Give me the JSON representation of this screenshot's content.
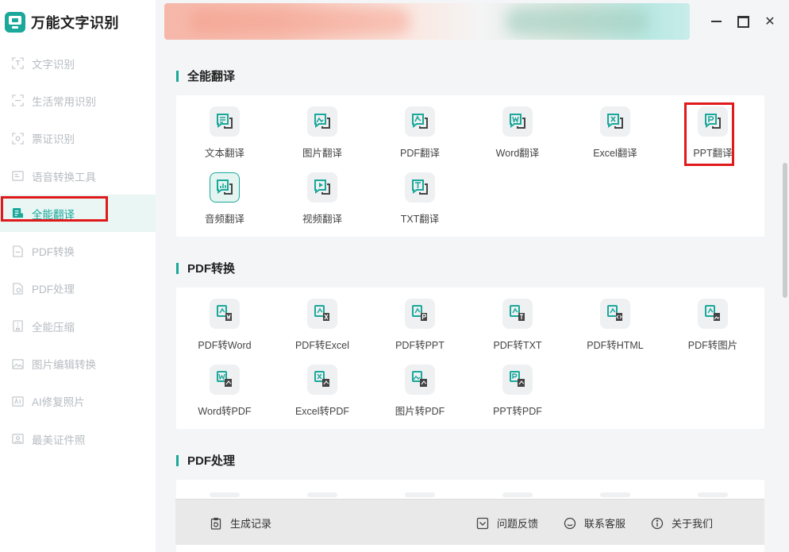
{
  "app": {
    "title": "万能文字识别"
  },
  "sidebar": {
    "items": [
      {
        "label": "文字识别",
        "icon": "scan-text-icon"
      },
      {
        "label": "生活常用识别",
        "icon": "scan-life-icon"
      },
      {
        "label": "票证识别",
        "icon": "scan-ticket-icon"
      },
      {
        "label": "语音转换工具",
        "icon": "voice-convert-icon"
      },
      {
        "label": "全能翻译",
        "icon": "translate-icon",
        "active": true
      },
      {
        "label": "PDF转换",
        "icon": "pdf-convert-icon"
      },
      {
        "label": "PDF处理",
        "icon": "pdf-process-icon"
      },
      {
        "label": "全能压缩",
        "icon": "compress-icon"
      },
      {
        "label": "图片编辑转换",
        "icon": "image-edit-icon"
      },
      {
        "label": "AI修复照片",
        "icon": "ai-repair-icon"
      },
      {
        "label": "最美证件照",
        "icon": "id-photo-icon"
      }
    ]
  },
  "sections": {
    "translate": {
      "title": "全能翻译",
      "tiles": [
        {
          "label": "文本翻译",
          "icon": "text-translate-icon"
        },
        {
          "label": "图片翻译",
          "icon": "image-translate-icon"
        },
        {
          "label": "PDF翻译",
          "icon": "pdf-translate-icon"
        },
        {
          "label": "Word翻译",
          "icon": "word-translate-icon"
        },
        {
          "label": "Excel翻译",
          "icon": "excel-translate-icon"
        },
        {
          "label": "PPT翻译",
          "icon": "ppt-translate-icon",
          "highlighted": true
        },
        {
          "label": "音频翻译",
          "icon": "audio-translate-icon"
        },
        {
          "label": "视频翻译",
          "icon": "video-translate-icon"
        },
        {
          "label": "TXT翻译",
          "icon": "txt-translate-icon"
        }
      ]
    },
    "pdf_convert": {
      "title": "PDF转换",
      "tiles": [
        {
          "label": "PDF转Word",
          "icon": "pdf-to-word-icon"
        },
        {
          "label": "PDF转Excel",
          "icon": "pdf-to-excel-icon"
        },
        {
          "label": "PDF转PPT",
          "icon": "pdf-to-ppt-icon"
        },
        {
          "label": "PDF转TXT",
          "icon": "pdf-to-txt-icon"
        },
        {
          "label": "PDF转HTML",
          "icon": "pdf-to-html-icon"
        },
        {
          "label": "PDF转图片",
          "icon": "pdf-to-image-icon"
        },
        {
          "label": "Word转PDF",
          "icon": "word-to-pdf-icon"
        },
        {
          "label": "Excel转PDF",
          "icon": "excel-to-pdf-icon"
        },
        {
          "label": "图片转PDF",
          "icon": "image-to-pdf-icon"
        },
        {
          "label": "PPT转PDF",
          "icon": "ppt-to-pdf-icon"
        }
      ]
    },
    "pdf_process": {
      "title": "PDF处理"
    }
  },
  "footer": {
    "history": "生成记录",
    "feedback": "问题反馈",
    "contact": "联系客服",
    "about": "关于我们"
  },
  "window": {
    "close_glyph": "✕"
  },
  "colors": {
    "accent": "#1aa89a",
    "highlight": "#e0191b"
  }
}
